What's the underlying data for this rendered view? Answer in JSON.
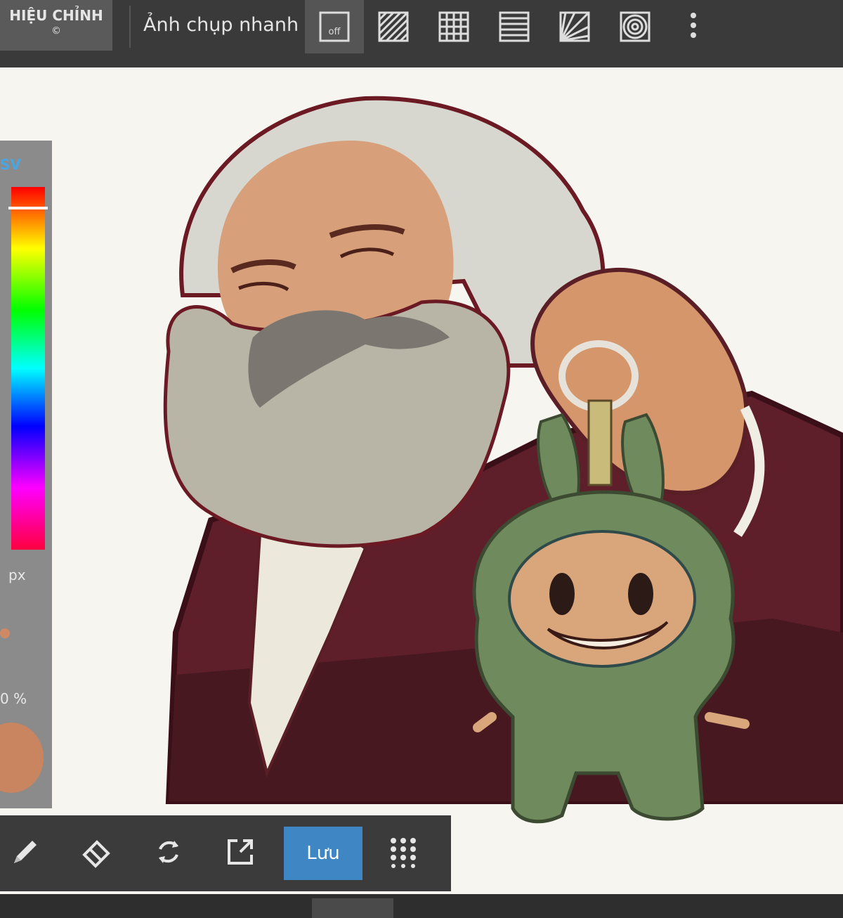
{
  "toolbar": {
    "edit_label": "HIỆU CHỈNH",
    "edit_sub": "©",
    "snapshot_label": "Ảnh chụp nhanh",
    "tools": [
      {
        "icon": "snap-off-icon",
        "label": "off"
      },
      {
        "icon": "diagonal-lines-icon"
      },
      {
        "icon": "grid-icon"
      },
      {
        "icon": "horizontal-lines-icon"
      },
      {
        "icon": "radial-lines-icon"
      },
      {
        "icon": "concentric-circles-icon"
      }
    ],
    "more_icon": "vertical-dots-icon"
  },
  "color_panel": {
    "mode": "SV",
    "size_unit": "px",
    "opacity": "0 %",
    "current_color": "#c98560"
  },
  "bottom": {
    "tools": [
      "pencil-icon",
      "eraser-icon",
      "transform-rotate-icon",
      "export-icon"
    ],
    "save_label": "Lưu",
    "menu_icon": "grid-menu-icon"
  },
  "colors": {
    "toolbar_bg": "#3a3a3a",
    "accent": "#3f86c4",
    "canvas": "#f6f5f0"
  }
}
